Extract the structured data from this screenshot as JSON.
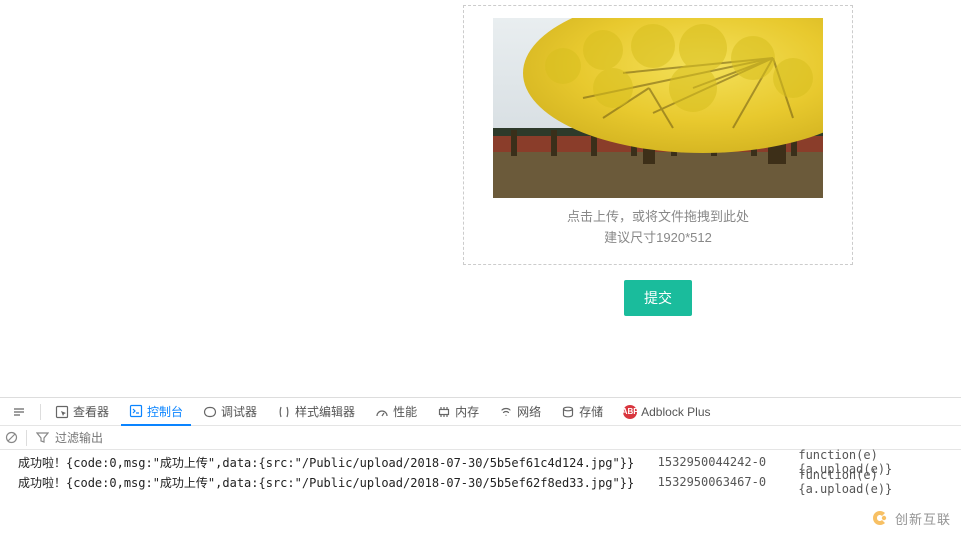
{
  "upload": {
    "hint1": "点击上传，或将文件拖拽到此处",
    "hint2": "建议尺寸1920*512",
    "submit_label": "提交"
  },
  "devtools": {
    "tabs": {
      "inspector": "查看器",
      "console": "控制台",
      "debugger": "调试器",
      "style": "样式编辑器",
      "performance": "性能",
      "memory": "内存",
      "network": "网络",
      "storage": "存储",
      "adblock": "Adblock Plus"
    },
    "filter_placeholder": "过滤输出",
    "log_rows": [
      {
        "prefix": "成功啦！",
        "body_a": "{code:0,msg:\"成功上传\",data:{src:",
        "body_path": "\"/Public/upload/2018-07-30/5b5ef61c4d124.jpg\"",
        "body_b": "}}",
        "timestamp": "1532950044242-0",
        "source": "function(e){a.upload(e)}",
        "underline": false
      },
      {
        "prefix": "成功啦！",
        "body_a": "{code:0,msg:\"成功上传\",data:{src:",
        "body_path": "\"/Public/upload/2018-07-30/5b5ef62f8ed33.jpg\"",
        "body_b": "}}",
        "timestamp": "1532950063467-0",
        "source": "function(e){a.upload(e)}",
        "underline": true
      }
    ]
  },
  "logo": {
    "text": "创新互联"
  }
}
